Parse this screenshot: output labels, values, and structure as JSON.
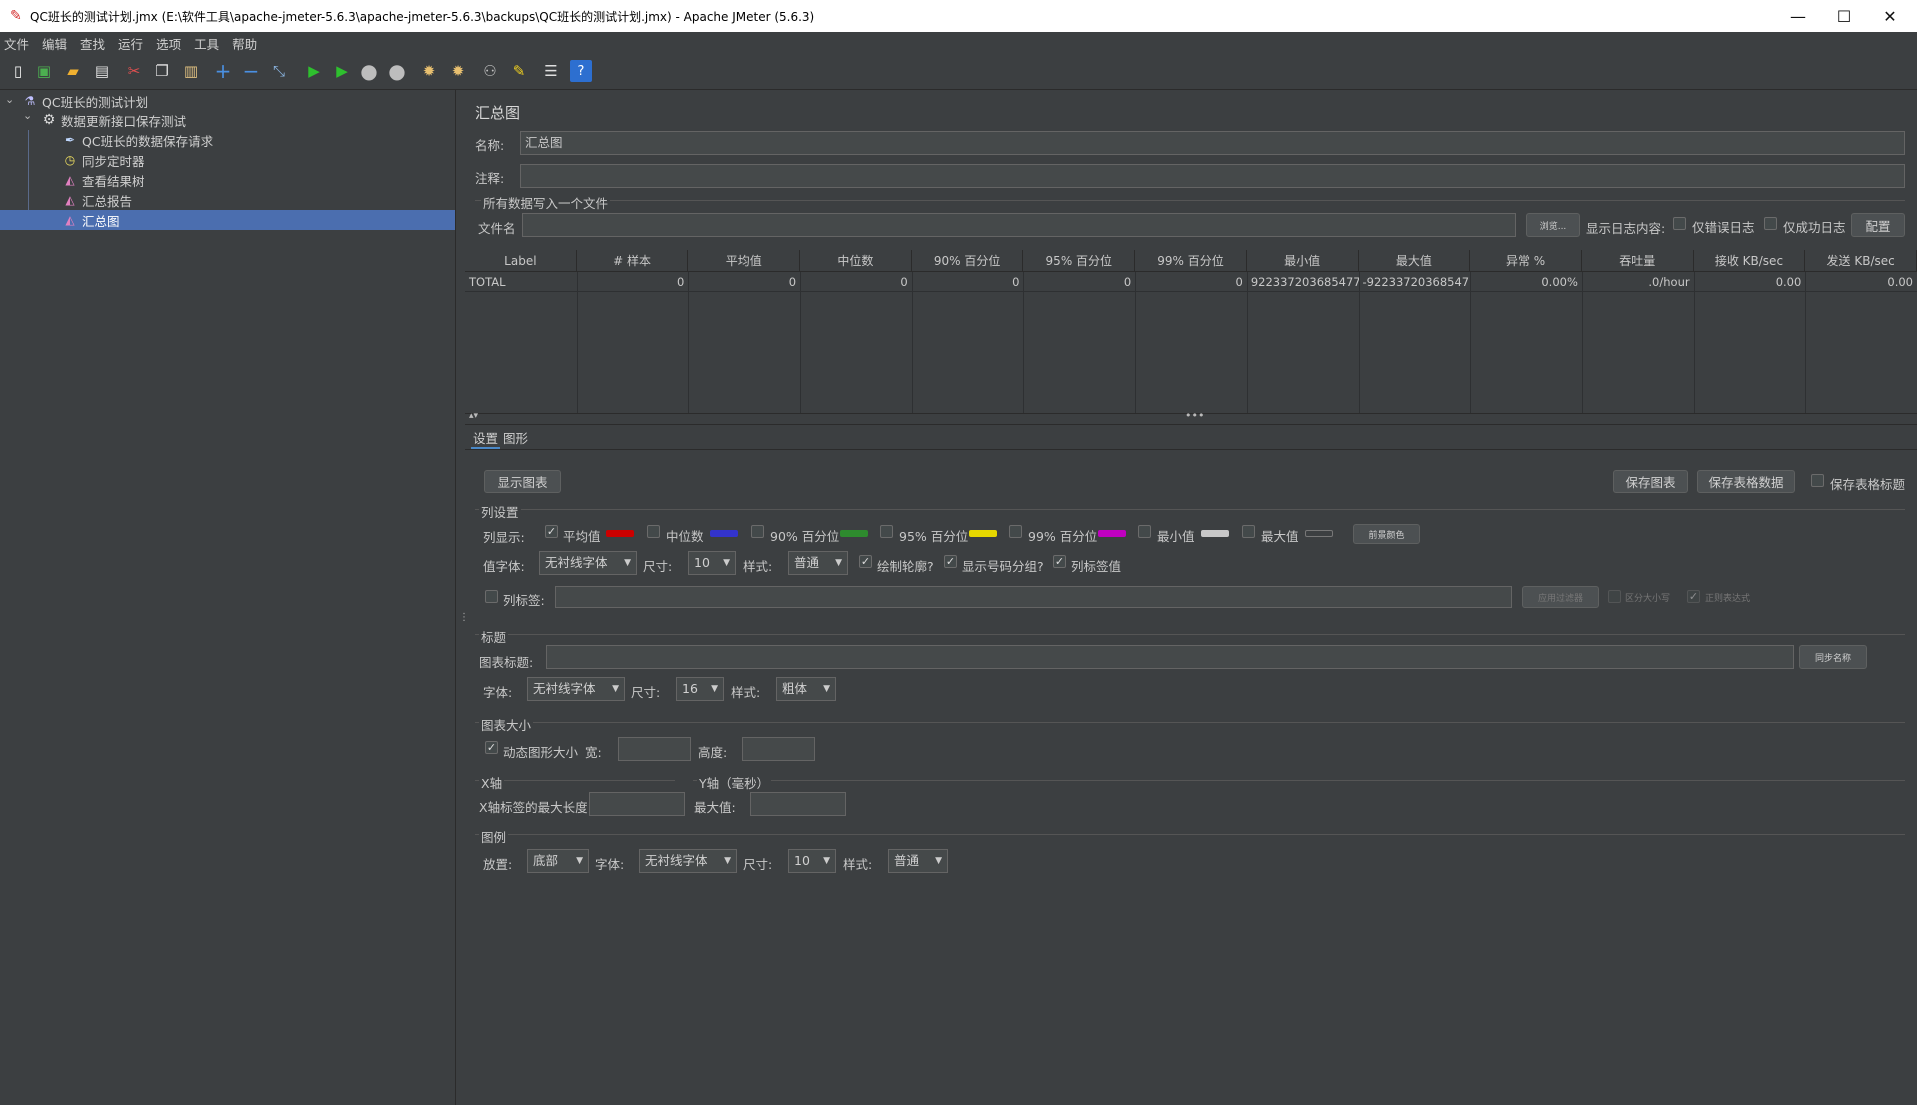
{
  "window": {
    "title": "QC班长的测试计划.jmx (E:\\软件工具\\apache-jmeter-5.6.3\\apache-jmeter-5.6.3\\backups\\QC班长的测试计划.jmx) - Apache JMeter (5.6.3)",
    "minimize": "—",
    "maximize": "☐",
    "close": "✕"
  },
  "menu": [
    "文件",
    "编辑",
    "查找",
    "运行",
    "选项",
    "工具",
    "帮助"
  ],
  "toolbar_icons": [
    "new-icon",
    "templates-icon",
    "open-icon",
    "save-icon",
    "cut-icon",
    "copy-icon",
    "paste-icon",
    "expand-icon",
    "collapse-icon",
    "toggle-icon",
    "start-icon",
    "start-no-pause-icon",
    "stop-icon",
    "shutdown-icon",
    "clear-icon",
    "clear-all-icon",
    "search-icon",
    "reset-search-icon",
    "function-helper-icon",
    "help-icon"
  ],
  "tree": {
    "root": "QC班长的测试计划",
    "thread_group": "数据更新接口保存测试",
    "items": [
      "QC班长的数据保存请求",
      "同步定时器",
      "查看结果树",
      "汇总报告",
      "汇总图"
    ]
  },
  "panel": {
    "title": "汇总图",
    "name_label": "名称:",
    "name_value": "汇总图",
    "comment_label": "注释:",
    "file_section": "所有数据写入一个文件",
    "filename_label": "文件名",
    "browse_btn": "浏览...",
    "log_content_label": "显示日志内容:",
    "errors_only": "仅错误日志",
    "success_only": "仅成功日志",
    "configure_btn": "配置"
  },
  "table": {
    "headers": [
      "Label",
      "# 样本",
      "平均值",
      "中位数",
      "90% 百分位",
      "95% 百分位",
      "99% 百分位",
      "最小值",
      "最大值",
      "异常 %",
      "吞吐量",
      "接收 KB/sec",
      "发送 KB/sec"
    ],
    "row": [
      "TOTAL",
      "0",
      "0",
      "0",
      "0",
      "0",
      "0",
      "922337203685477...",
      "-92233720368547...",
      "0.00%",
      ".0/hour",
      "0.00",
      "0.00"
    ]
  },
  "tabs": [
    "设置",
    "图形"
  ],
  "settings": {
    "show_graph_btn": "显示图表",
    "save_graph_btn": "保存图表",
    "save_table_btn": "保存表格数据",
    "save_table_header": "保存表格标题",
    "columns_section": "列设置",
    "columns_display_label": "列显示:",
    "columns": [
      {
        "label": "平均值",
        "checked": true,
        "color": "#cc0000"
      },
      {
        "label": "中位数",
        "checked": false,
        "color": "#3333cc"
      },
      {
        "label": "90% 百分位",
        "checked": false,
        "color": "#2e8b2e"
      },
      {
        "label": "95% 百分位",
        "checked": false,
        "color": "#e6d800"
      },
      {
        "label": "99% 百分位",
        "checked": false,
        "color": "#c000c0"
      },
      {
        "label": "最小值",
        "checked": false,
        "color": "#c8c8c8"
      },
      {
        "label": "最大值",
        "checked": false,
        "color": "#3c3f41"
      }
    ],
    "bar_color_btn": "前景颜色",
    "value_font_label": "值字体:",
    "value_font": "无衬线字体",
    "size_label": "尺寸:",
    "value_size": "10",
    "style_label": "样式:",
    "value_style": "普通",
    "draw_outline": "绘制轮廓?",
    "show_number_grouping": "显示号码分组?",
    "value_labels": "列标签值",
    "column_label_filter": "列标签:",
    "apply_filter_btn": "应用过滤器",
    "case_sensitive": "区分大小写",
    "regex": "正则表达式",
    "title_section": "标题",
    "chart_title_label": "图表标题:",
    "sync_name_btn": "同步名称",
    "font_label": "字体:",
    "title_font": "无衬线字体",
    "title_size": "16",
    "title_style": "粗体",
    "graph_size_section": "图表大小",
    "dynamic_size": "动态图形大小",
    "width_label": "宽:",
    "height_label": "高度:",
    "x_axis_section": "X轴",
    "y_axis_section": "Y轴（毫秒）",
    "x_max_label": "X轴标签的最大长度",
    "y_max_label": "最大值:",
    "legend_section": "图例",
    "placement_label": "放置:",
    "legend_placement": "底部",
    "legend_font": "无衬线字体",
    "legend_size": "10",
    "legend_style": "普通"
  }
}
